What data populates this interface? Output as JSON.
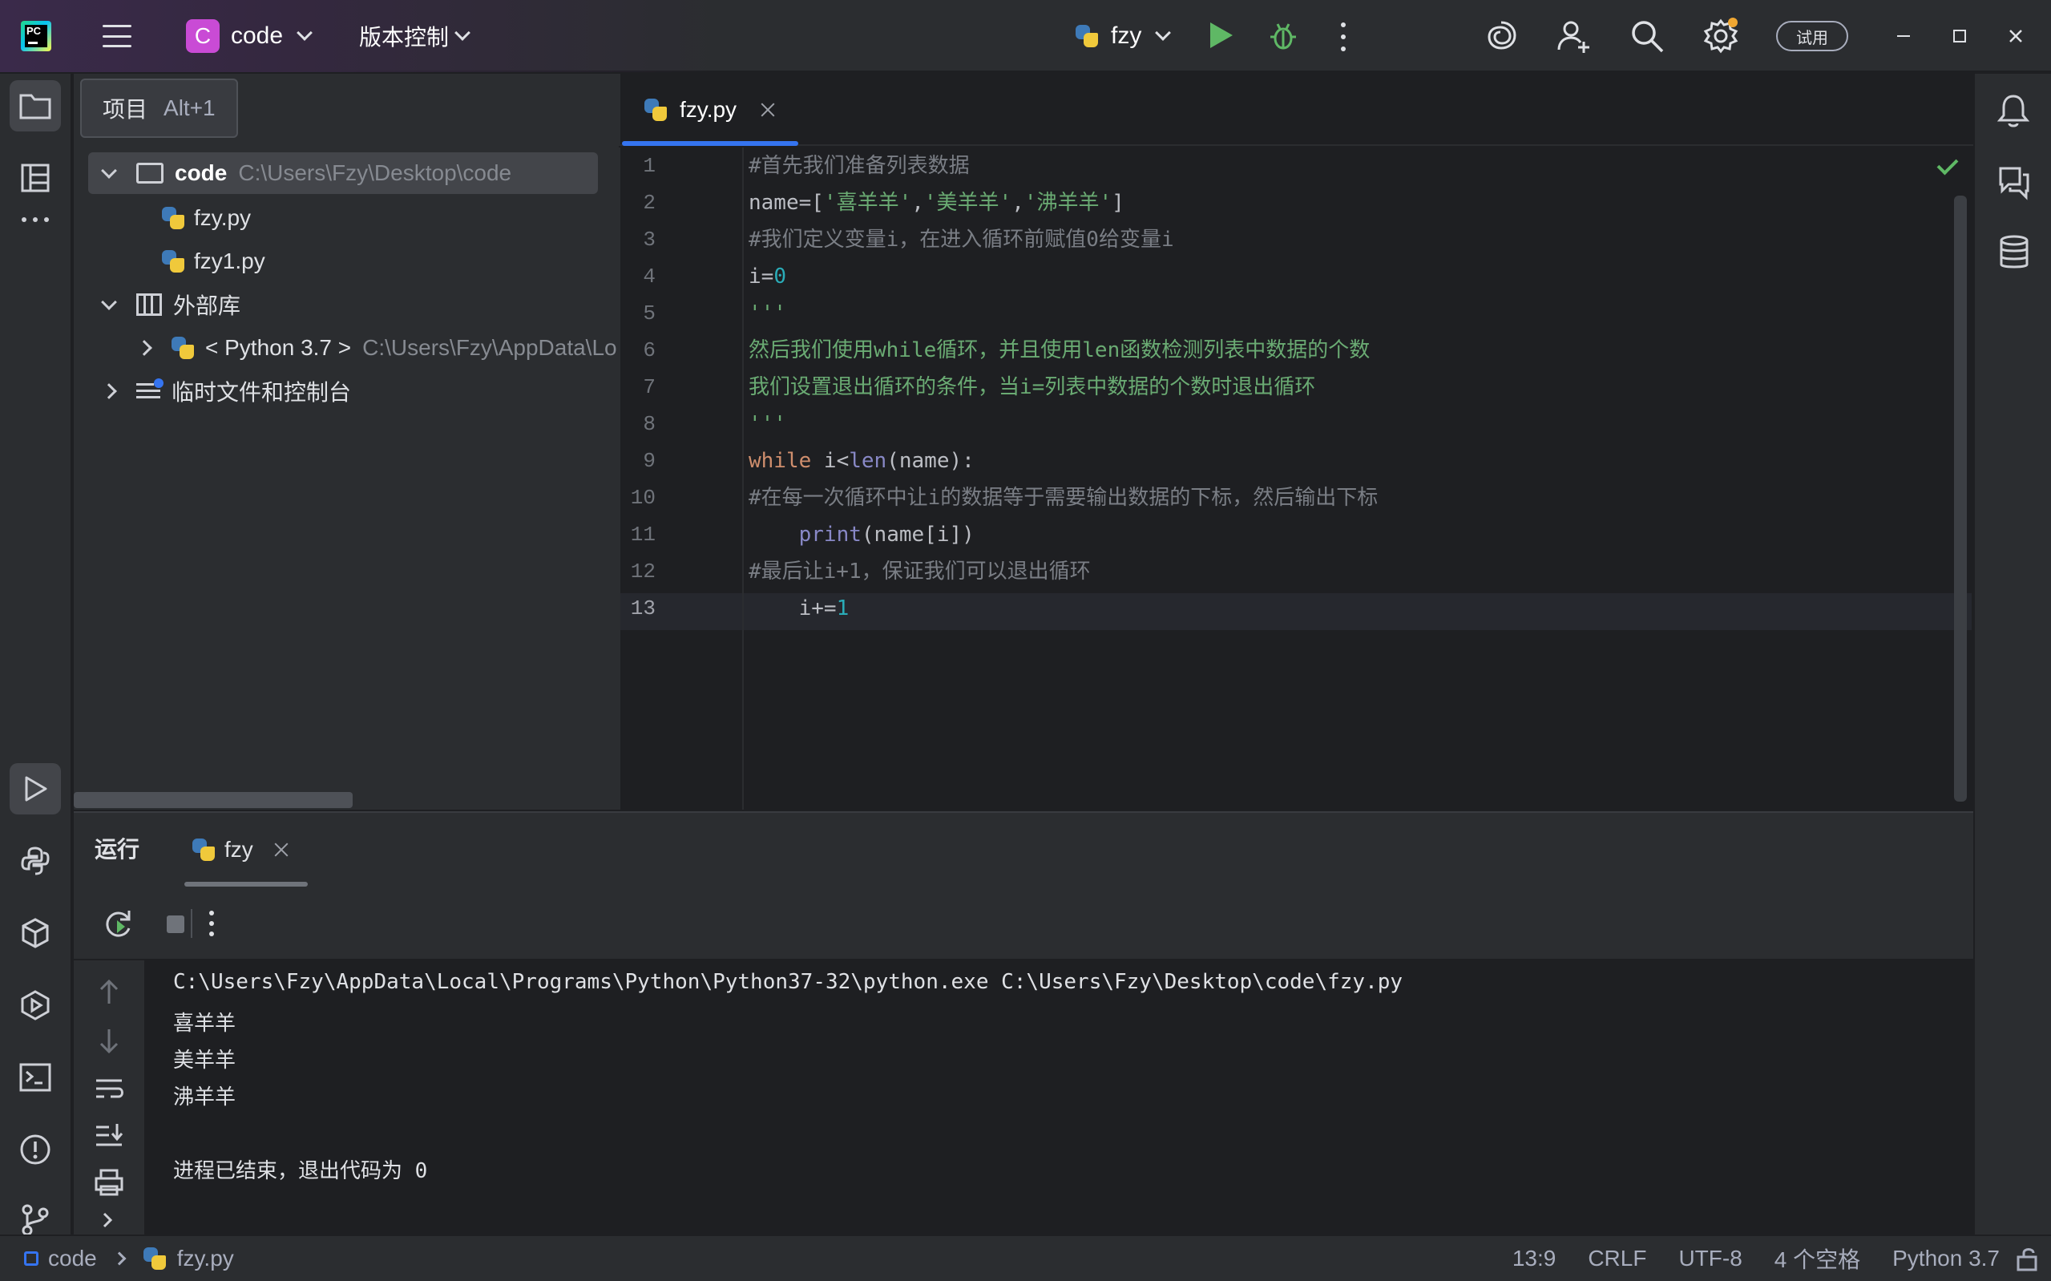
{
  "titlebar": {
    "project_badge": "C",
    "project_name": "code",
    "vcs_label": "版本控制",
    "run_config": "fzy",
    "trial_label": "试用"
  },
  "project_panel": {
    "tooltip_label": "项目",
    "tooltip_shortcut": "Alt+1",
    "root_name": "code",
    "root_path": "C:\\Users\\Fzy\\Desktop\\code",
    "files": [
      "fzy.py",
      "fzy1.py"
    ],
    "external_libs": "外部库",
    "python_sdk": "< Python 3.7 >",
    "python_sdk_path": "C:\\Users\\Fzy\\AppData\\Lo",
    "scratches": "临时文件和控制台"
  },
  "editor": {
    "tab_label": "fzy.py",
    "line_numbers": [
      "1",
      "2",
      "3",
      "4",
      "5",
      "6",
      "7",
      "8",
      "9",
      "10",
      "11",
      "12",
      "13"
    ],
    "lines": {
      "l1": "#首先我们准备列表数据",
      "l2a": "name=[",
      "l2b": "'喜羊羊'",
      "l2c": ",",
      "l2d": "'美羊羊'",
      "l2e": ",",
      "l2f": "'沸羊羊'",
      "l2g": "]",
      "l3": "#我们定义变量i，在进入循环前赋值0给变量i",
      "l4a": "i=",
      "l4b": "0",
      "l5": "'''",
      "l6": "然后我们使用while循环，并且使用len函数检测列表中数据的个数",
      "l7": "我们设置退出循环的条件，当i=列表中数据的个数时退出循环",
      "l8": "'''",
      "l9a": "while",
      "l9b": " i<",
      "l9c": "len",
      "l9d": "(name):",
      "l10": "#在每一次循环中让i的数据等于需要输出数据的下标，然后输出下标",
      "l11a": "    ",
      "l11b": "print",
      "l11c": "(name[i])",
      "l12": "#最后让i+1，保证我们可以退出循环",
      "l13a": "    i+=",
      "l13b": "1"
    }
  },
  "run_panel": {
    "title": "运行",
    "tab_label": "fzy",
    "console": [
      "C:\\Users\\Fzy\\AppData\\Local\\Programs\\Python\\Python37-32\\python.exe C:\\Users\\Fzy\\Desktop\\code\\fzy.py",
      "喜羊羊",
      "美羊羊",
      "沸羊羊",
      "",
      "进程已结束，退出代码为 0"
    ]
  },
  "statusbar": {
    "crumb_project": "code",
    "crumb_file": "fzy.py",
    "position": "13:9",
    "line_sep": "CRLF",
    "encoding": "UTF-8",
    "indent": "4 个空格",
    "interpreter": "Python 3.7"
  },
  "colors": {
    "accent": "#3574f0",
    "run_green": "#5fb865",
    "project_badge": "#c94bd5"
  }
}
